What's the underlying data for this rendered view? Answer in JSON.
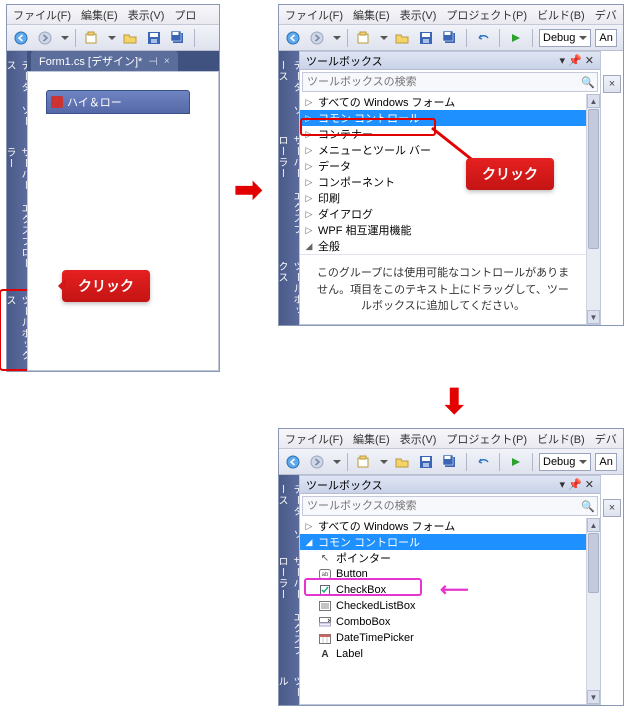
{
  "menus": {
    "file": "ファイル(F)",
    "edit": "編集(E)",
    "view": "表示(V)",
    "project": "プロジェクト(P)",
    "project_short": "プロ",
    "build": "ビルド(B)",
    "deb": "デバ",
    "any": "An"
  },
  "combo": {
    "debug": "Debug"
  },
  "sidetabs": {
    "datasrc": "データ ソース",
    "srvexp": "サーバー エクスプローラー",
    "toolbox": "ツールボックス",
    "toolbox_short": "ツール"
  },
  "doctab": {
    "label": "Form1.cs [デザイン]*",
    "pin": "⊣",
    "close": "×"
  },
  "form": {
    "title": "ハイ＆ロー"
  },
  "toolbox": {
    "title": "ツールボックス",
    "searchPlaceholder": "ツールボックスの検索",
    "searchGlyph": "🔍",
    "pin": "▾",
    "thumb": "📌",
    "close": "✕",
    "cats": {
      "allwin": "すべての Windows フォーム",
      "common": "コモン コントロール",
      "container": "コンテナー",
      "menutool": "メニューとツール バー",
      "data": "データ",
      "component": "コンポーネント",
      "print": "印刷",
      "dialog": "ダイアログ",
      "wpf": "WPF 相互運用機能",
      "general": "全般"
    },
    "emptyMsg": "このグループには使用可能なコントロールがありません。項目をこのテキスト上にドラッグして、ツールボックスに追加してください。",
    "items": {
      "pointer": "ポインター",
      "button": "Button",
      "checkbox": "CheckBox",
      "checkedlistbox": "CheckedListBox",
      "combobox": "ComboBox",
      "datetimepicker": "DateTimePicker",
      "label": "Label"
    }
  },
  "callouts": {
    "click": "クリック"
  },
  "glyphs": {
    "tri_r": "▷",
    "tri_d": "◢",
    "arrow_right": "➡",
    "arrow_down": "⬇",
    "leftarrow": "⟵",
    "x": "×"
  }
}
